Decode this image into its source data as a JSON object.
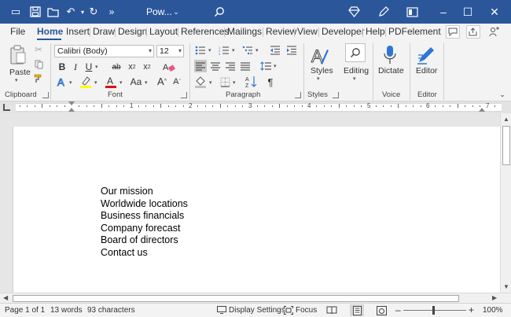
{
  "titlebar": {
    "title": "Pow...",
    "bg_color": "#2b579a"
  },
  "tabs": [
    {
      "label": "File"
    },
    {
      "label": "Home"
    },
    {
      "label": "Insert"
    },
    {
      "label": "Draw"
    },
    {
      "label": "Design"
    },
    {
      "label": "Layout"
    },
    {
      "label": "References"
    },
    {
      "label": "Mailings"
    },
    {
      "label": "Review"
    },
    {
      "label": "View"
    },
    {
      "label": "Developer"
    },
    {
      "label": "Help"
    },
    {
      "label": "PDFelement"
    }
  ],
  "ribbon": {
    "clipboard": {
      "label": "Clipboard",
      "paste": "Paste"
    },
    "font": {
      "label": "Font",
      "font_name": "Calibri (Body)",
      "font_size": "12"
    },
    "paragraph": {
      "label": "Paragraph"
    },
    "styles": {
      "label": "Styles",
      "styles_btn": "Styles",
      "editing_btn": "Editing"
    },
    "voice": {
      "label": "Voice",
      "dictate": "Dictate"
    },
    "editor": {
      "label": "Editor",
      "editor_btn": "Editor"
    }
  },
  "ruler": {
    "numbers": [
      "1",
      "2",
      "3",
      "4",
      "5",
      "6",
      "7"
    ]
  },
  "document": {
    "paragraphs": [
      "Our mission",
      "Worldwide locations",
      "Business financials",
      "Company forecast",
      "Board of directors",
      "Contact us"
    ]
  },
  "status": {
    "page": "Page 1 of 1",
    "words": "13 words",
    "characters": "93 characters",
    "display_settings": "Display Settings",
    "focus": "Focus",
    "zoom": "100%"
  },
  "colors": {
    "accent": "#2b579a",
    "font_color_bar": "#e01010",
    "highlight_bar": "#ffff00"
  }
}
